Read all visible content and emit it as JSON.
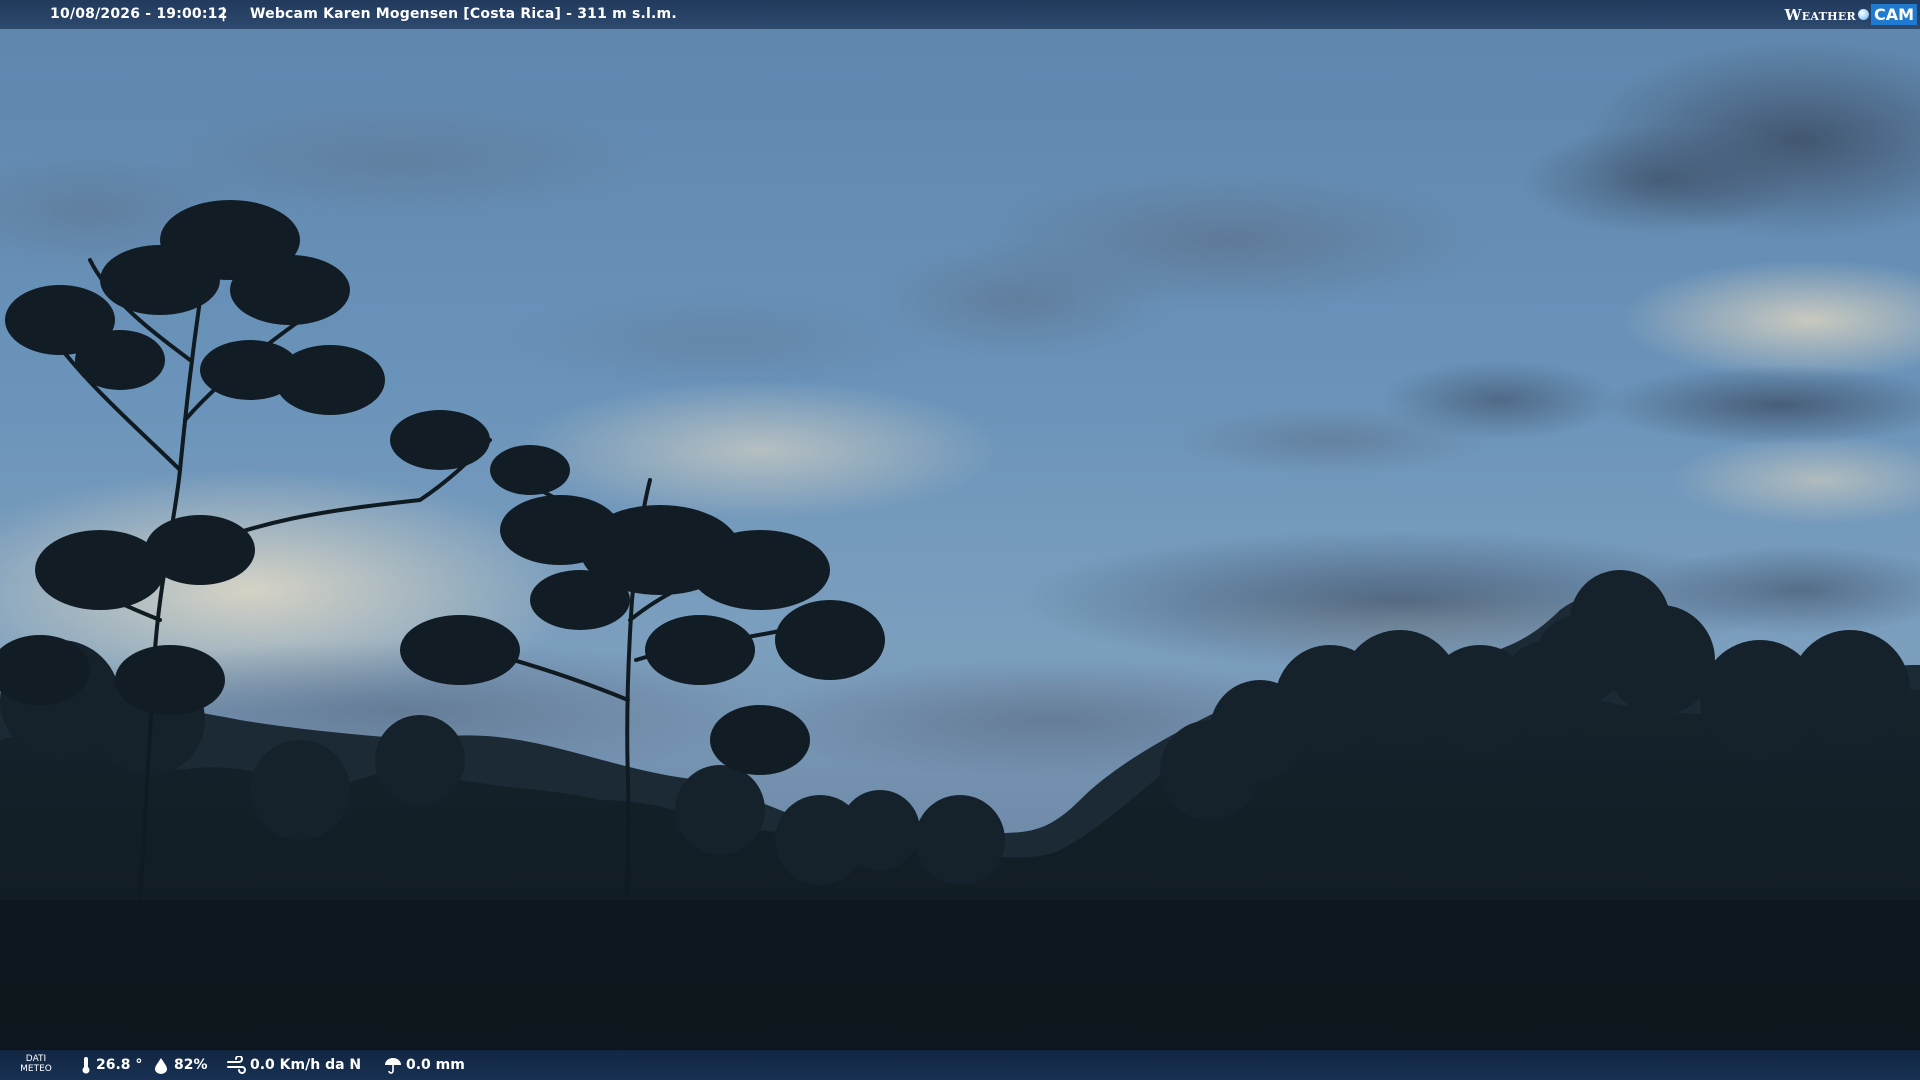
{
  "overlay": {
    "datetime": "10/08/2026 - 19:00:12",
    "separator": "|",
    "title": "Webcam Karen Mogensen [Costa Rica]  - 311 m s.l.m.",
    "brand_left": "Weather",
    "brand_right": "CAM"
  },
  "weather": {
    "label_line1": "DATI",
    "label_line2": "METEO",
    "temperature": "26.8 °",
    "humidity": "82%",
    "wind": "0.0 Km/h da N",
    "rain": "0.0 mm"
  }
}
